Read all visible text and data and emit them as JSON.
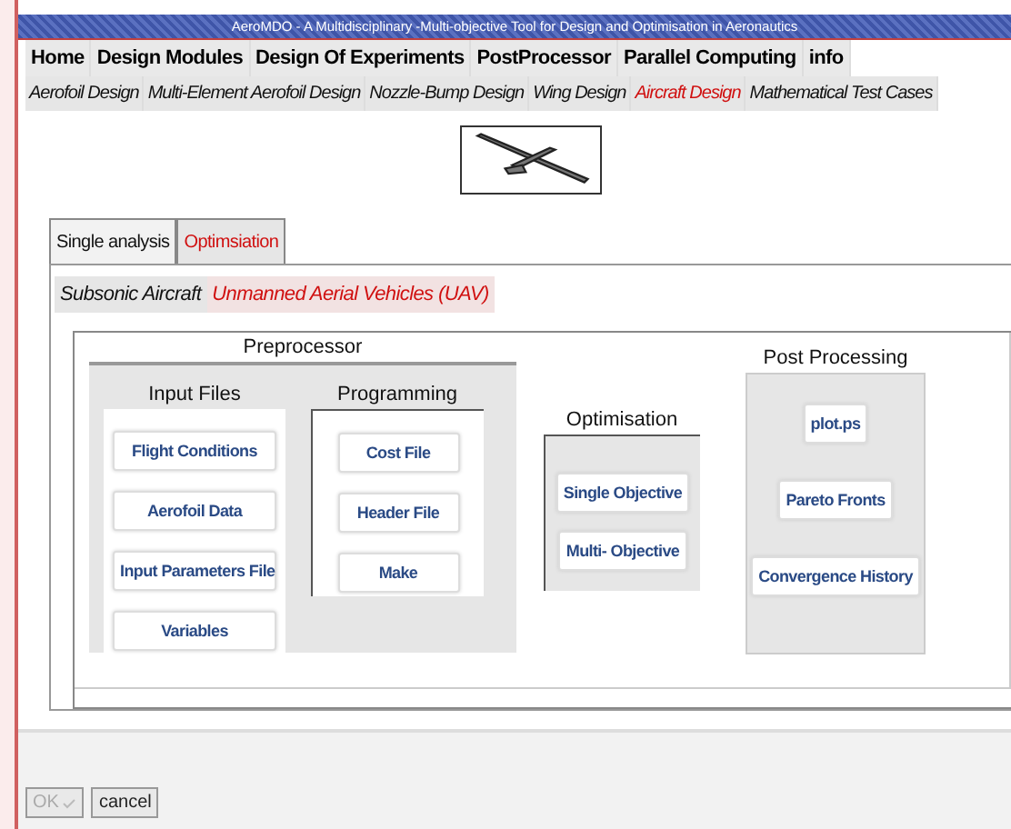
{
  "window": {
    "title": "AeroMDO - A Multidisciplinary -Multi-objective Tool  for Design and Optimisation in Aeronautics"
  },
  "menu": [
    {
      "label": "Home"
    },
    {
      "label": "Design Modules"
    },
    {
      "label": "Design Of Experiments"
    },
    {
      "label": "PostProcessor"
    },
    {
      "label": "Parallel Computing"
    },
    {
      "label": "info"
    }
  ],
  "modules": [
    {
      "label": "Aerofoil Design",
      "selected": false
    },
    {
      "label": "Multi-Element Aerofoil Design",
      "selected": false
    },
    {
      "label": "Nozzle-Bump Design",
      "selected": false
    },
    {
      "label": "Wing Design",
      "selected": false
    },
    {
      "label": "Aircraft Design",
      "selected": true
    },
    {
      "label": "Mathematical Test Cases",
      "selected": false
    }
  ],
  "analysis_tabs": [
    {
      "label": "Single analysis",
      "selected": false
    },
    {
      "label": "Optimsiation",
      "selected": true
    }
  ],
  "aircraft_tabs": [
    {
      "label": "Subsonic Aircraft",
      "selected": false
    },
    {
      "label": "Unmanned Aerial Vehicles (UAV)",
      "selected": true
    }
  ],
  "preprocessor": {
    "title": "Preprocessor",
    "input_files": {
      "title": "Input Files",
      "buttons": [
        "Flight Conditions",
        "Aerofoil Data",
        "Input Parameters File",
        "Variables"
      ]
    },
    "programming": {
      "title": "Programming",
      "buttons": [
        "Cost File",
        "Header File",
        "Make"
      ]
    }
  },
  "optimisation": {
    "title": "Optimisation",
    "buttons": [
      "Single Objective",
      "Multi- Objective"
    ]
  },
  "post_processing": {
    "title": "Post Processing",
    "buttons": [
      "plot.ps",
      "Pareto Fronts",
      "Convergence History"
    ]
  },
  "footer_buttons": [
    {
      "label": "OK",
      "disabled": true
    },
    {
      "label": "cancel",
      "disabled": false
    }
  ]
}
